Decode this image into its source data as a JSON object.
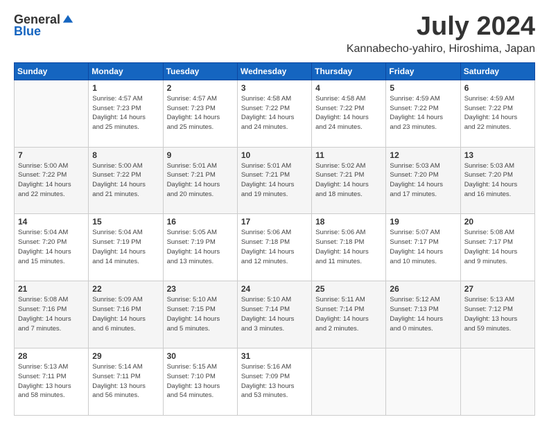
{
  "header": {
    "logo_general": "General",
    "logo_blue": "Blue",
    "month_title": "July 2024",
    "location": "Kannabecho-yahiro, Hiroshima, Japan"
  },
  "weekdays": [
    "Sunday",
    "Monday",
    "Tuesday",
    "Wednesday",
    "Thursday",
    "Friday",
    "Saturday"
  ],
  "weeks": [
    [
      {
        "day": "",
        "info": ""
      },
      {
        "day": "1",
        "info": "Sunrise: 4:57 AM\nSunset: 7:23 PM\nDaylight: 14 hours\nand 25 minutes."
      },
      {
        "day": "2",
        "info": "Sunrise: 4:57 AM\nSunset: 7:23 PM\nDaylight: 14 hours\nand 25 minutes."
      },
      {
        "day": "3",
        "info": "Sunrise: 4:58 AM\nSunset: 7:22 PM\nDaylight: 14 hours\nand 24 minutes."
      },
      {
        "day": "4",
        "info": "Sunrise: 4:58 AM\nSunset: 7:22 PM\nDaylight: 14 hours\nand 24 minutes."
      },
      {
        "day": "5",
        "info": "Sunrise: 4:59 AM\nSunset: 7:22 PM\nDaylight: 14 hours\nand 23 minutes."
      },
      {
        "day": "6",
        "info": "Sunrise: 4:59 AM\nSunset: 7:22 PM\nDaylight: 14 hours\nand 22 minutes."
      }
    ],
    [
      {
        "day": "7",
        "info": "Sunrise: 5:00 AM\nSunset: 7:22 PM\nDaylight: 14 hours\nand 22 minutes."
      },
      {
        "day": "8",
        "info": "Sunrise: 5:00 AM\nSunset: 7:22 PM\nDaylight: 14 hours\nand 21 minutes."
      },
      {
        "day": "9",
        "info": "Sunrise: 5:01 AM\nSunset: 7:21 PM\nDaylight: 14 hours\nand 20 minutes."
      },
      {
        "day": "10",
        "info": "Sunrise: 5:01 AM\nSunset: 7:21 PM\nDaylight: 14 hours\nand 19 minutes."
      },
      {
        "day": "11",
        "info": "Sunrise: 5:02 AM\nSunset: 7:21 PM\nDaylight: 14 hours\nand 18 minutes."
      },
      {
        "day": "12",
        "info": "Sunrise: 5:03 AM\nSunset: 7:20 PM\nDaylight: 14 hours\nand 17 minutes."
      },
      {
        "day": "13",
        "info": "Sunrise: 5:03 AM\nSunset: 7:20 PM\nDaylight: 14 hours\nand 16 minutes."
      }
    ],
    [
      {
        "day": "14",
        "info": "Sunrise: 5:04 AM\nSunset: 7:20 PM\nDaylight: 14 hours\nand 15 minutes."
      },
      {
        "day": "15",
        "info": "Sunrise: 5:04 AM\nSunset: 7:19 PM\nDaylight: 14 hours\nand 14 minutes."
      },
      {
        "day": "16",
        "info": "Sunrise: 5:05 AM\nSunset: 7:19 PM\nDaylight: 14 hours\nand 13 minutes."
      },
      {
        "day": "17",
        "info": "Sunrise: 5:06 AM\nSunset: 7:18 PM\nDaylight: 14 hours\nand 12 minutes."
      },
      {
        "day": "18",
        "info": "Sunrise: 5:06 AM\nSunset: 7:18 PM\nDaylight: 14 hours\nand 11 minutes."
      },
      {
        "day": "19",
        "info": "Sunrise: 5:07 AM\nSunset: 7:17 PM\nDaylight: 14 hours\nand 10 minutes."
      },
      {
        "day": "20",
        "info": "Sunrise: 5:08 AM\nSunset: 7:17 PM\nDaylight: 14 hours\nand 9 minutes."
      }
    ],
    [
      {
        "day": "21",
        "info": "Sunrise: 5:08 AM\nSunset: 7:16 PM\nDaylight: 14 hours\nand 7 minutes."
      },
      {
        "day": "22",
        "info": "Sunrise: 5:09 AM\nSunset: 7:16 PM\nDaylight: 14 hours\nand 6 minutes."
      },
      {
        "day": "23",
        "info": "Sunrise: 5:10 AM\nSunset: 7:15 PM\nDaylight: 14 hours\nand 5 minutes."
      },
      {
        "day": "24",
        "info": "Sunrise: 5:10 AM\nSunset: 7:14 PM\nDaylight: 14 hours\nand 3 minutes."
      },
      {
        "day": "25",
        "info": "Sunrise: 5:11 AM\nSunset: 7:14 PM\nDaylight: 14 hours\nand 2 minutes."
      },
      {
        "day": "26",
        "info": "Sunrise: 5:12 AM\nSunset: 7:13 PM\nDaylight: 14 hours\nand 0 minutes."
      },
      {
        "day": "27",
        "info": "Sunrise: 5:13 AM\nSunset: 7:12 PM\nDaylight: 13 hours\nand 59 minutes."
      }
    ],
    [
      {
        "day": "28",
        "info": "Sunrise: 5:13 AM\nSunset: 7:11 PM\nDaylight: 13 hours\nand 58 minutes."
      },
      {
        "day": "29",
        "info": "Sunrise: 5:14 AM\nSunset: 7:11 PM\nDaylight: 13 hours\nand 56 minutes."
      },
      {
        "day": "30",
        "info": "Sunrise: 5:15 AM\nSunset: 7:10 PM\nDaylight: 13 hours\nand 54 minutes."
      },
      {
        "day": "31",
        "info": "Sunrise: 5:16 AM\nSunset: 7:09 PM\nDaylight: 13 hours\nand 53 minutes."
      },
      {
        "day": "",
        "info": ""
      },
      {
        "day": "",
        "info": ""
      },
      {
        "day": "",
        "info": ""
      }
    ]
  ]
}
